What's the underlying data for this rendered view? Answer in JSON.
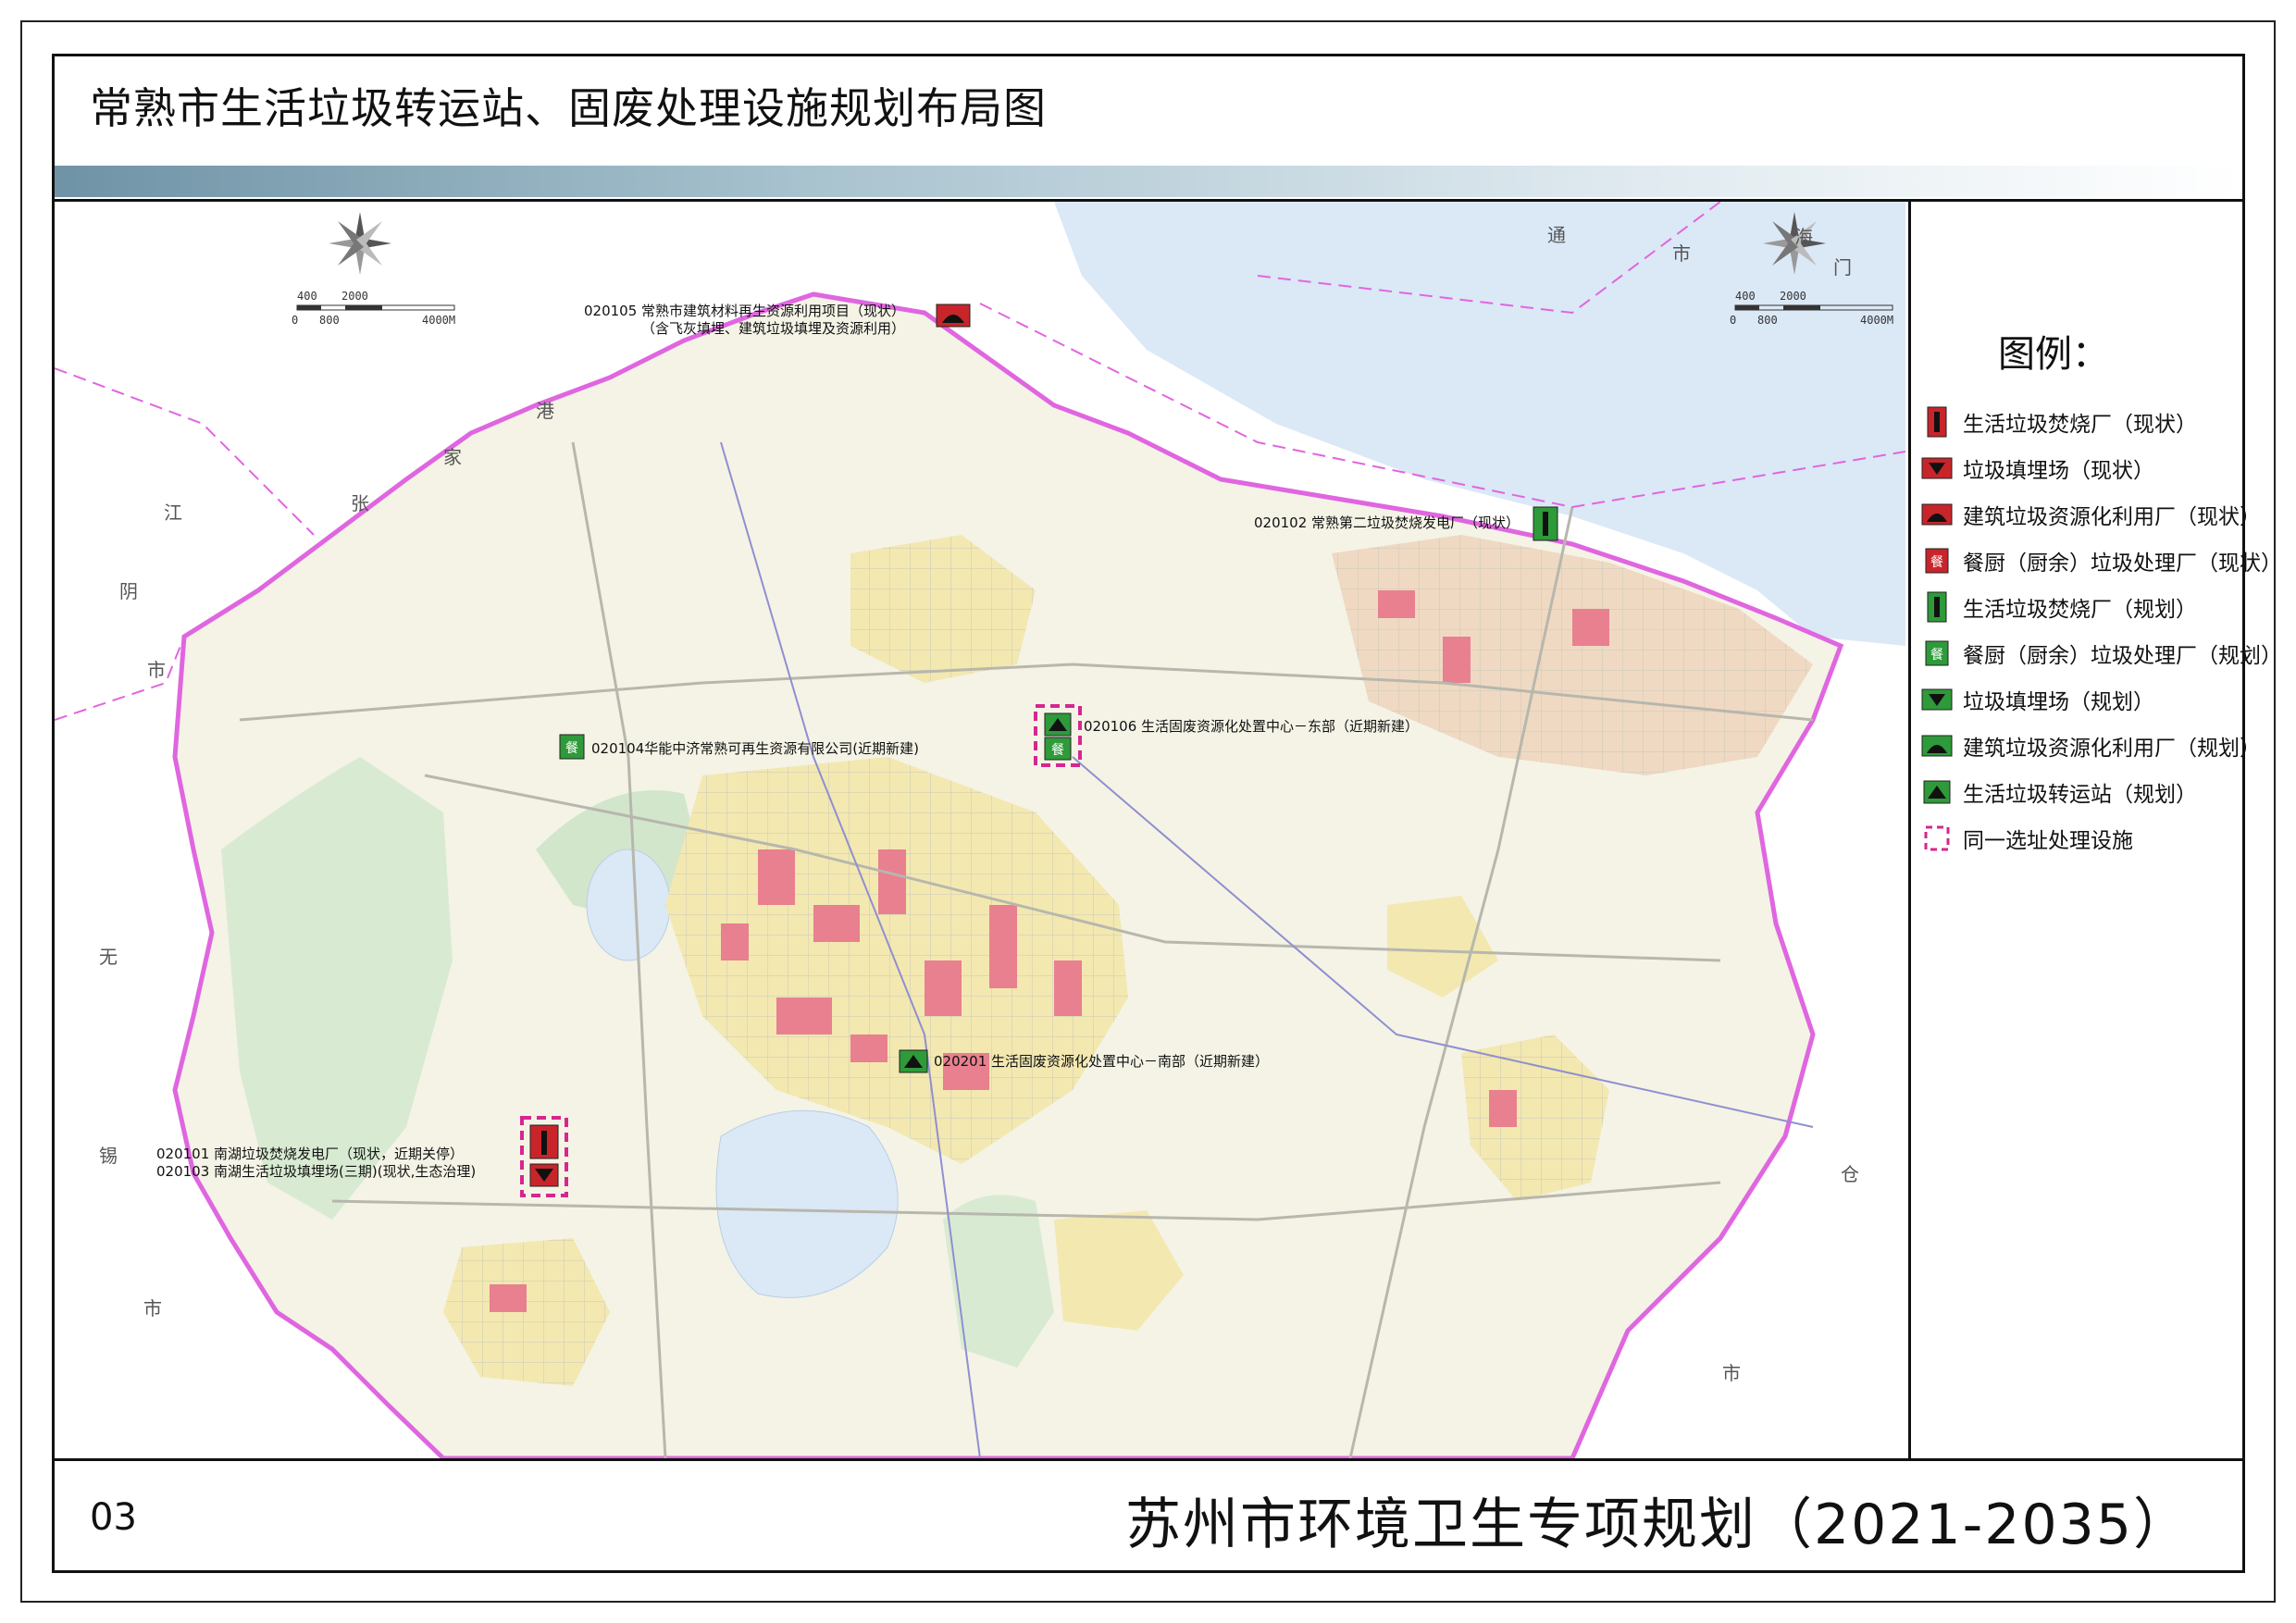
{
  "header": {
    "title": "常熟市生活垃圾转运站、固废处理设施规划布局图"
  },
  "footer": {
    "page_number": "03",
    "document_title": "苏州市环境卫生专项规划（2021-2035）"
  },
  "legend": {
    "title": "图例：",
    "items": [
      {
        "icon": "incinerator-existing-icon",
        "label": "生活垃圾焚烧厂（现状）",
        "color": "#c8252b"
      },
      {
        "icon": "landfill-existing-icon",
        "label": "垃圾填埋场（现状）",
        "color": "#c8252b"
      },
      {
        "icon": "construction-waste-existing-icon",
        "label": "建筑垃圾资源化利用厂（现状）",
        "color": "#c8252b"
      },
      {
        "icon": "kitchen-waste-existing-icon",
        "label": "餐厨（厨余）垃圾处理厂（现状）",
        "color": "#c8252b"
      },
      {
        "icon": "incinerator-planned-icon",
        "label": "生活垃圾焚烧厂（规划）",
        "color": "#2e9a3a"
      },
      {
        "icon": "kitchen-waste-planned-icon",
        "label": "餐厨（厨余）垃圾处理厂（规划）",
        "color": "#2e9a3a"
      },
      {
        "icon": "landfill-planned-icon",
        "label": "垃圾填埋场（规划）",
        "color": "#2e9a3a"
      },
      {
        "icon": "construction-waste-planned-icon",
        "label": "建筑垃圾资源化利用厂（规划）",
        "color": "#2e9a3a"
      },
      {
        "icon": "transfer-station-planned-icon",
        "label": "生活垃圾转运站（规划）",
        "color": "#2e9a3a"
      },
      {
        "icon": "co-located-site-icon",
        "label": "同一选址处理设施",
        "color": "#d6268f"
      }
    ]
  },
  "scale": {
    "labels_top": [
      "400",
      "2000"
    ],
    "labels_bottom": [
      "0",
      "800",
      "4000M"
    ]
  },
  "map": {
    "colors": {
      "water": "#dbe8f6",
      "boundary": "#e066e0",
      "urban_red": "#e8808f",
      "urban_yellow": "#f5f0b4",
      "green": "#cfe8c8",
      "background": "#f4f4ee"
    },
    "facilities": [
      {
        "name": "020105-site",
        "lines": [
          "020105 常熟市建筑材料再生资源利用项目（现状）",
          "（含飞灰填埋、建筑垃圾填埋及资源利用）"
        ]
      },
      {
        "name": "020102-site",
        "lines": [
          "020102 常熟第二垃圾焚烧发电厂（现状）"
        ]
      },
      {
        "name": "020106-site",
        "lines": [
          "020106 生活固废资源化处置中心－东部（近期新建）"
        ]
      },
      {
        "name": "020104-site",
        "lines": [
          "020104华能中济常熟可再生资源有限公司(近期新建)"
        ]
      },
      {
        "name": "020201-site",
        "lines": [
          "020201 生活固废资源化处置中心－南部（近期新建）"
        ]
      },
      {
        "name": "020101-site",
        "lines": [
          "020101 南湖垃圾焚烧发电厂（现状，近期关停）",
          "020103 南湖生活垃圾填埋场(三期)(现状,生态治理)"
        ]
      }
    ],
    "place_labels": [
      "通",
      "市",
      "海",
      "门",
      "港",
      "家",
      "江",
      "张",
      "阴",
      "市",
      "无",
      "锡",
      "市",
      "仓",
      "市"
    ],
    "north_arrow": "north-arrow-icon"
  }
}
